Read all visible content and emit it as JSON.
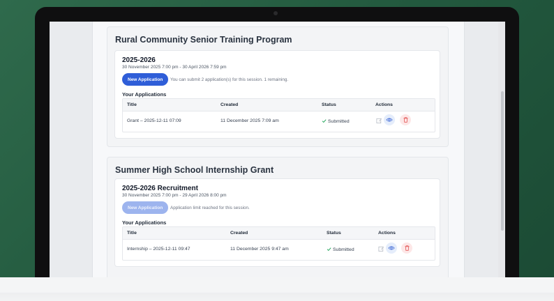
{
  "programs": [
    {
      "title": "Rural Community Senior Training Program",
      "session": {
        "name": "2025-2026",
        "dates": "30 November 2025 7:00 pm - 30 April 2026 7:59 pm",
        "button_label": "New Application",
        "button_enabled": true,
        "hint": "You can submit 2 application(s) for this session. 1 remaining."
      },
      "your_applications_label": "Your Applications",
      "table": {
        "headers": [
          "Title",
          "Created",
          "Status",
          "Actions"
        ],
        "rows": [
          {
            "title": "Grant – 2025-12-11 07:09",
            "created": "11 December 2025 7:09 am",
            "status": "Submitted"
          }
        ]
      }
    },
    {
      "title": "Summer High School Internship Grant",
      "session": {
        "name": "2025-2026 Recruitment",
        "dates": "30 November 2025 7:00 pm - 29 April 2026 8:00 pm",
        "button_label": "New Application",
        "button_enabled": false,
        "hint": "Application limit reached for this session."
      },
      "your_applications_label": "Your Applications",
      "table": {
        "headers": [
          "Title",
          "Created",
          "Status",
          "Actions"
        ],
        "rows": [
          {
            "title": "Internship – 2025-12-11 09:47",
            "created": "11 December 2025 9:47 am",
            "status": "Submitted"
          }
        ]
      }
    }
  ],
  "icons": {
    "status": "check-icon",
    "edit": "pencil-icon",
    "view": "eye-icon",
    "delete": "trash-icon"
  },
  "colors": {
    "primary": "#2f5ed8",
    "primary_disabled": "#9db4ee",
    "success": "#22a65a",
    "danger": "#e25555",
    "view_bg": "#e5edfb",
    "delete_bg": "#fde7e7"
  }
}
